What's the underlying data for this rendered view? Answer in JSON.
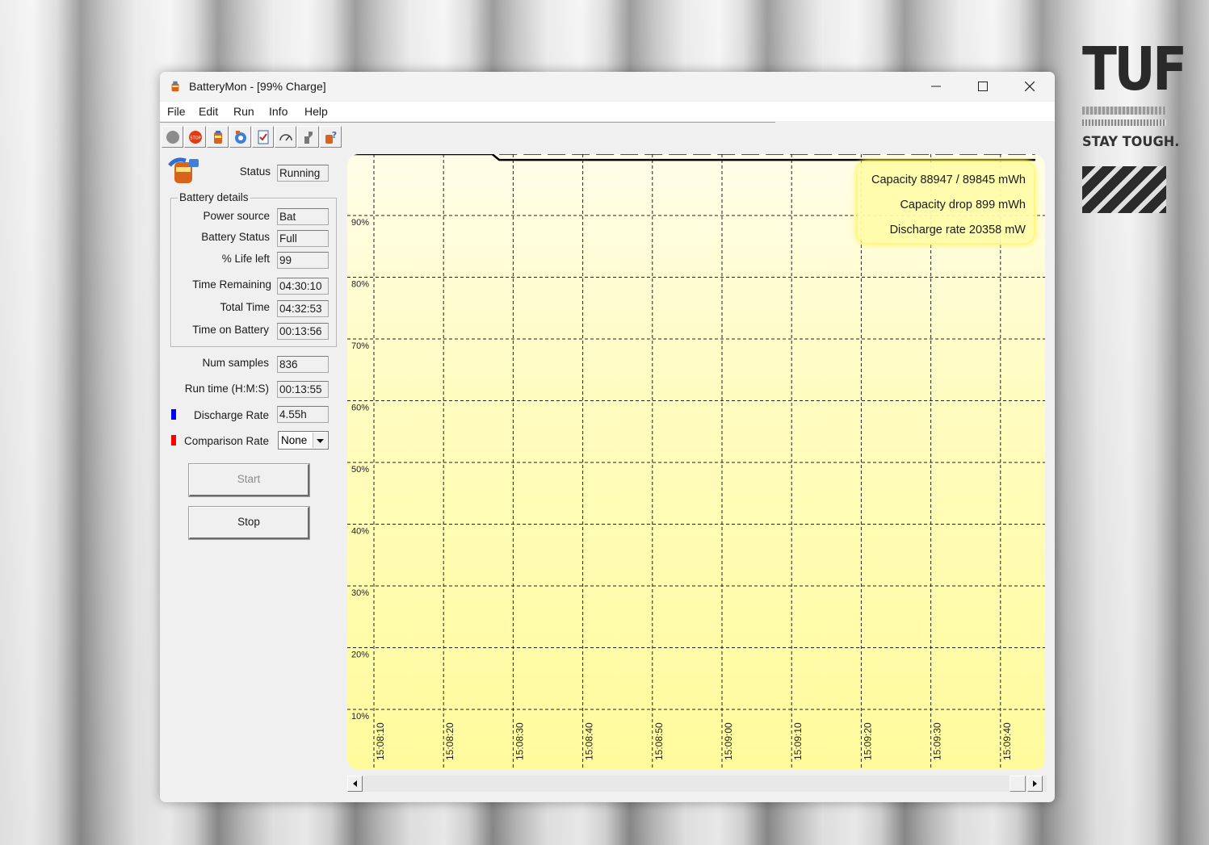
{
  "desktop": {
    "brand": "TUF",
    "slogan": "STAY TOUGH."
  },
  "window": {
    "title": "BatteryMon - [99% Charge]"
  },
  "menu": [
    "File",
    "Edit",
    "Run",
    "Info",
    "Help"
  ],
  "toolbar": {
    "icons": [
      "record-icon",
      "stop-icon",
      "battery-icon",
      "settings-icon",
      "checklist-icon",
      "gauge-icon",
      "hand-icon",
      "help-icon"
    ]
  },
  "status": {
    "label": "Status",
    "value": "Running"
  },
  "battery_details": {
    "title": "Battery details",
    "fields": [
      {
        "label": "Power source",
        "value": "Bat"
      },
      {
        "label": "Battery Status",
        "value": "Full"
      },
      {
        "label": "% Life left",
        "value": "99"
      },
      {
        "label": "Time Remaining",
        "value": "04:30:10"
      },
      {
        "label": "Total Time",
        "value": "04:32:53"
      },
      {
        "label": "Time on Battery",
        "value": "00:13:56"
      }
    ]
  },
  "stats": {
    "num_samples": {
      "label": "Num samples",
      "value": "836"
    },
    "run_time": {
      "label": "Run time (H:M:S)",
      "value": "00:13:55"
    },
    "discharge_rate": {
      "label": "Discharge Rate",
      "value": "4.55h",
      "color": "#0000ff"
    },
    "comparison_rate": {
      "label": "Comparison Rate",
      "value": "None",
      "color": "#ff0000"
    }
  },
  "buttons": {
    "start": "Start",
    "stop": "Stop"
  },
  "legend": {
    "capacity": "Capacity 88947 / 89845 mWh",
    "capacity_drop": "Capacity drop 899 mWh",
    "discharge_rate": "Discharge rate 20358 mW"
  },
  "chart_data": {
    "type": "line",
    "y_ticks": [
      "90%",
      "80%",
      "70%",
      "60%",
      "50%",
      "40%",
      "30%",
      "20%",
      "10%"
    ],
    "x_ticks": [
      "15:08:10",
      "15:08:20",
      "15:08:30",
      "15:08:40",
      "15:08:50",
      "15:09:00",
      "15:09:10",
      "15:09:20",
      "15:09:30",
      "15:09:40"
    ],
    "ylim": [
      10,
      100
    ],
    "grid": true,
    "series": [
      {
        "color": "#000000",
        "style": "solid",
        "x": [
          "15:08:07",
          "15:08:27",
          "15:08:28",
          "15:09:45"
        ],
        "y": [
          100,
          100,
          99,
          99
        ]
      },
      {
        "color": "#0000cc",
        "style": "dashed",
        "x": [
          "15:08:28",
          "15:09:45"
        ],
        "y": [
          100,
          100
        ]
      }
    ],
    "colors": {
      "background_top": "#fffde8",
      "background_bottom": "#fffb9c"
    }
  }
}
